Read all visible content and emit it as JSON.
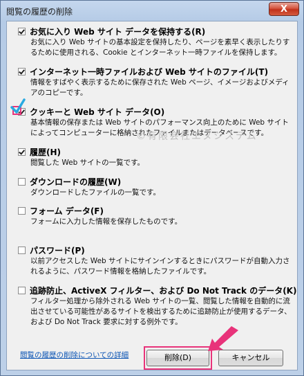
{
  "window": {
    "title": "閲覧の履歴の削除",
    "close_symbol": "X"
  },
  "options": [
    {
      "label": "お気に入り Web サイト データを保持する(R)",
      "checked": true,
      "desc": "お気に入り Web サイトの基本設定を保持したり、ページを素早く表示したりするために使用される、Cookie とインターネット一時ファイルを保持します。"
    },
    {
      "label": "インターネット一時ファイルおよび Web サイトのファイル(T)",
      "checked": true,
      "desc": "情報をすばやく表示するために保存された Web ページ、イメージおよびメディアのコピーです。"
    },
    {
      "label": "クッキーと Web サイト データ(O)",
      "checked": true,
      "desc": "基本情報の保存または Web サイトのパフォーマンス向上のために Web サイトによってコンピューターに格納されたファイルまたはデータベースです。"
    },
    {
      "label": "履歴(H)",
      "checked": true,
      "desc": "閲覧した Web サイトの一覧です。"
    },
    {
      "label": "ダウンロードの履歴(W)",
      "checked": false,
      "desc": "ダウンロードしたファイルの一覧です。"
    },
    {
      "label": "フォーム データ(F)",
      "checked": false,
      "desc": "フォームに入力した情報を保存したものです。"
    },
    {
      "label": "パスワード(P)",
      "checked": false,
      "desc": "以前アクセスした Web サイトにサインインするときにパスワードが自動入力されるように、パスワード情報を格納したファイルです。"
    },
    {
      "label": "追跡防止、ActiveX フィルター、および Do Not Track のデータ(K)",
      "checked": false,
      "desc": "フィルター処理から除外される Web サイトの一覧、閲覧した情報を自動的に流出させている可能性があるサイトを検出するために追跡防止が使用するデータ、および Do Not Track 要求に対する例外です。"
    }
  ],
  "watermark": "©有限会社エヌシステム",
  "footer": {
    "link": "閲覧の履歴の削除についての詳細",
    "delete_button": "削除(D)",
    "cancel_button": "キャンセル"
  },
  "colors": {
    "highlight": "#e8337a",
    "link": "#0b54b4",
    "checkmark": "#29a9e1"
  }
}
